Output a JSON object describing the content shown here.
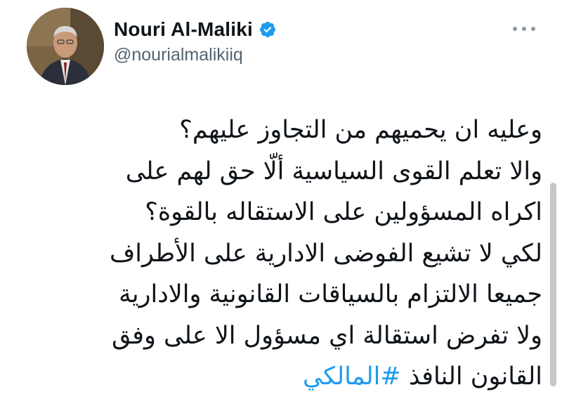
{
  "author": {
    "display_name": "Nouri Al-Maliki",
    "handle": "@nourialmalikiiq",
    "verified": true
  },
  "tweet": {
    "lines": [
      "وعليه ان يحميهم من التجاوز عليهم؟",
      "والا تعلم القوى السياسية ألّا حق لهم على",
      "اكراه المسؤولين على الاستقاله بالقوة؟",
      "لكي لا تشيع الفوضى الادارية على الأطراف",
      "جميعا الالتزام بالسياقات القانونية والادارية",
      "ولا تفرض استقالة اي مسؤول الا على وفق"
    ],
    "last_line_text": "القانون النافذ",
    "hashtag": "#المالكي"
  },
  "icons": {
    "verified": "verified-badge-icon",
    "more": "more-options-icon"
  },
  "colors": {
    "accent": "#1d9bf0",
    "text": "#0f1419",
    "secondary": "#536471"
  }
}
